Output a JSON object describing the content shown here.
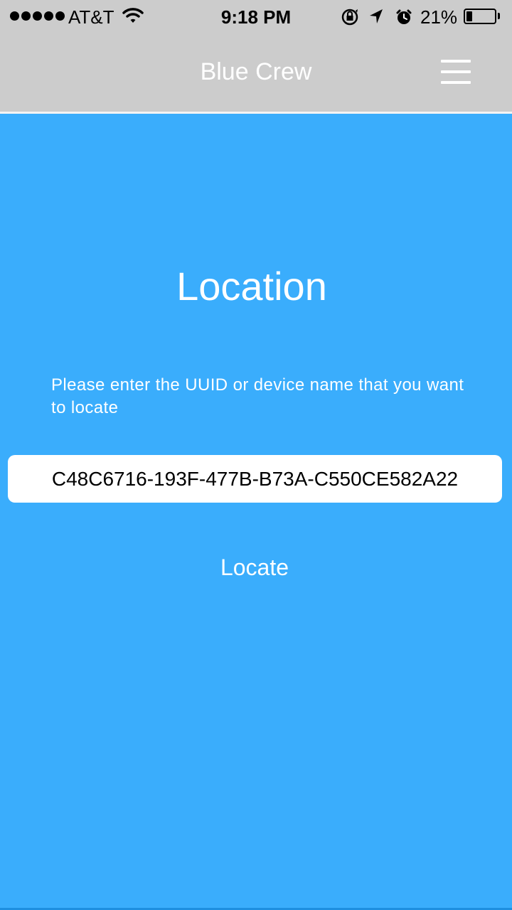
{
  "status_bar": {
    "carrier": "AT&T",
    "time": "9:18 PM",
    "battery_percent_label": "21%",
    "battery_level": 0.21,
    "icons": [
      "signal-dots-icon",
      "wifi-icon",
      "orientation-lock-icon",
      "location-arrow-icon",
      "alarm-icon",
      "battery-icon"
    ]
  },
  "nav": {
    "title": "Blue Crew",
    "menu_icon": "hamburger-menu-icon"
  },
  "main": {
    "heading": "Location",
    "instruction": "Please enter the UUID or device name that you want to locate",
    "uuid_value": "C48C6716-193F-477B-B73A-C550CE582A22",
    "locate_label": "Locate"
  },
  "colors": {
    "header_bg": "#cccccc",
    "content_bg": "#3aadfc",
    "text": "#ffffff"
  }
}
